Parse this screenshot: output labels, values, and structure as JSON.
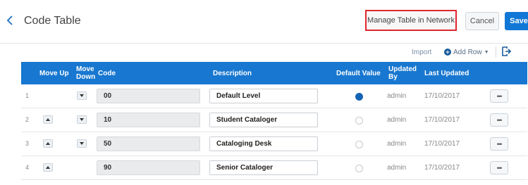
{
  "header": {
    "title": "Code Table",
    "manage_label": "Manage Table in Network",
    "cancel_label": "Cancel",
    "save_label": "Save"
  },
  "toolbar": {
    "import_label": "Import",
    "add_row_label": "Add Row",
    "add_icon": "plus-circle-icon",
    "export_icon": "export-icon"
  },
  "table": {
    "columns": {
      "move_up": "Move Up",
      "move_down_1": "Move",
      "move_down_2": "Down",
      "code": "Code",
      "description": "Description",
      "default_value": "Default Value",
      "updated_by_1": "Updated",
      "updated_by_2": "By",
      "last_updated": "Last Updated"
    },
    "rows": [
      {
        "num": "1",
        "code": "00",
        "description": "Default Level",
        "default": true,
        "updated_by": "admin",
        "last_updated": "17/10/2017",
        "more": "•••"
      },
      {
        "num": "2",
        "code": "10",
        "description": "Student Cataloger",
        "default": false,
        "updated_by": "admin",
        "last_updated": "17/10/2017",
        "more": "•••"
      },
      {
        "num": "3",
        "code": "50",
        "description": "Cataloging Desk",
        "default": false,
        "updated_by": "admin",
        "last_updated": "17/10/2017",
        "more": "•••"
      },
      {
        "num": "4",
        "code": "90",
        "description": "Senior Cataloger",
        "default": false,
        "updated_by": "admin",
        "last_updated": "17/10/2017",
        "more": "•••"
      }
    ]
  },
  "colors": {
    "header_blue": "#1877d0",
    "save_blue": "#1177d6",
    "highlight_red": "#e0262d",
    "radio_checked": "#1563b5"
  }
}
